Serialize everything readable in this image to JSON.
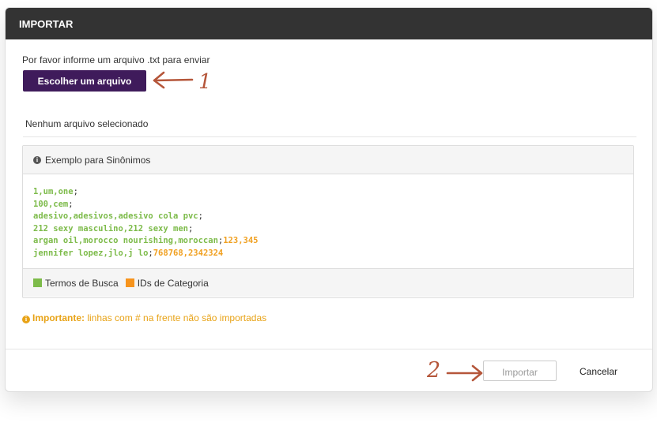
{
  "modal": {
    "title": "IMPORTAR",
    "intro_text": "Por favor informe um arquivo .txt para enviar",
    "choose_file_label": "Escolher um arquivo",
    "file_status": "Nenhum arquivo selecionado",
    "annotation_step_1": "1",
    "annotation_step_2": "2"
  },
  "example": {
    "title": "Exemplo para Sinônimos",
    "lines": [
      {
        "terms": "1,um,one",
        "separator": ";",
        "categories": ""
      },
      {
        "terms": "100,cem",
        "separator": ";",
        "categories": ""
      },
      {
        "terms": "adesivo,adesivos,adesivo cola pvc",
        "separator": ";",
        "categories": ""
      },
      {
        "terms": "212 sexy masculino,212 sexy men",
        "separator": ";",
        "categories": ""
      },
      {
        "terms": "argan oil,morocco nourishing,moroccan",
        "separator": ";",
        "categories": "123,345"
      },
      {
        "terms": "jennifer lopez,jlo,j lo",
        "separator": ";",
        "categories": "768768,2342324"
      }
    ],
    "legend": {
      "terms_label": "Termos de Busca",
      "categories_label": "IDs de Categoria"
    }
  },
  "notice": {
    "bold": "Importante:",
    "text": " linhas com # na frente não são importadas"
  },
  "footer": {
    "import_label": "Importar",
    "cancel_label": "Cancelar"
  },
  "colors": {
    "header_bg": "#333333",
    "primary_button": "#3f1b5b",
    "terms_color": "#7dbb4a",
    "categories_color": "#f0a020",
    "notice_color": "#e8a317",
    "annotation_color": "#b5563a"
  },
  "icons": {
    "example_icon": "info-icon",
    "notice_icon": "info-icon",
    "annotation_arrow": "hand-drawn-arrow-icon"
  }
}
